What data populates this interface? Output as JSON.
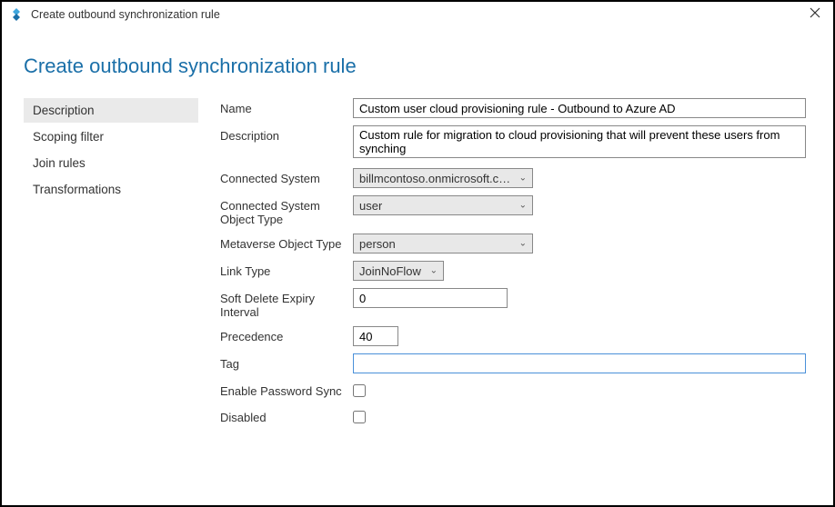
{
  "window": {
    "title": "Create outbound synchronization rule"
  },
  "page": {
    "heading": "Create outbound synchronization rule"
  },
  "sidebar": {
    "items": [
      {
        "label": "Description",
        "active": true
      },
      {
        "label": "Scoping filter",
        "active": false
      },
      {
        "label": "Join rules",
        "active": false
      },
      {
        "label": "Transformations",
        "active": false
      }
    ]
  },
  "form": {
    "labels": {
      "name": "Name",
      "description": "Description",
      "connected_system": "Connected System",
      "connected_system_object_type": "Connected System Object Type",
      "metaverse_object_type": "Metaverse Object Type",
      "link_type": "Link Type",
      "soft_delete": "Soft Delete Expiry Interval",
      "precedence": "Precedence",
      "tag": "Tag",
      "enable_password_sync": "Enable Password Sync",
      "disabled": "Disabled"
    },
    "values": {
      "name": "Custom user cloud provisioning rule - Outbound to Azure AD",
      "description": "Custom rule for migration to cloud provisioning that will prevent these users from synching",
      "connected_system": "billmcontoso.onmicrosoft.com - ,",
      "connected_system_object_type": "user",
      "metaverse_object_type": "person",
      "link_type": "JoinNoFlow",
      "soft_delete": "0",
      "precedence": "40",
      "tag": ""
    }
  }
}
